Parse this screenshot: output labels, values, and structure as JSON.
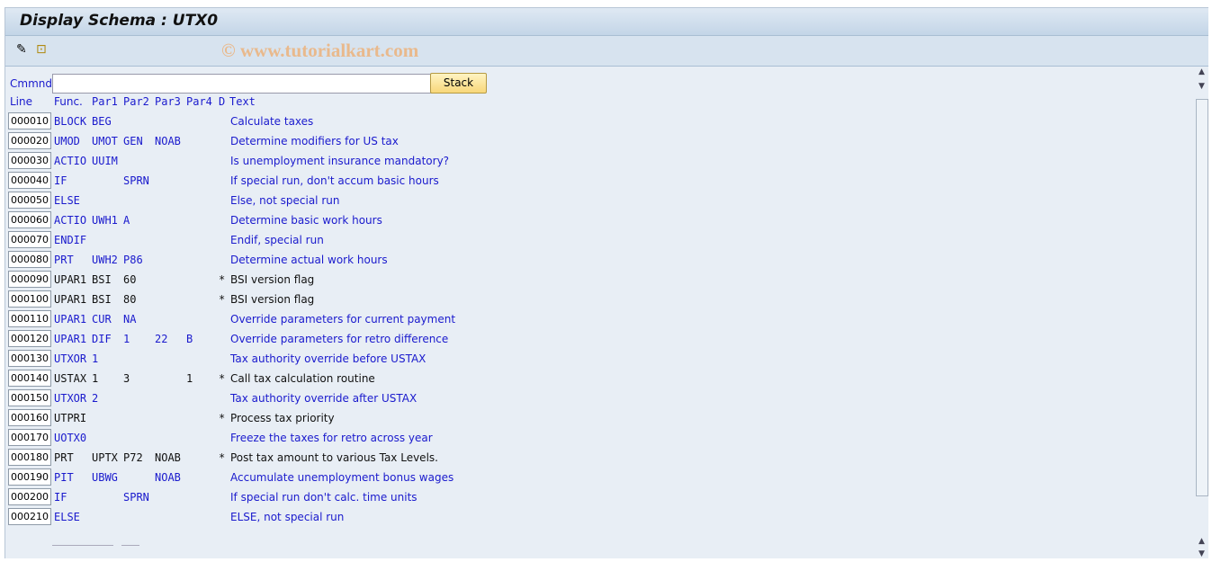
{
  "title": "Display Schema : UTX0",
  "watermark": "© www.tutorialkart.com",
  "toolbar": {
    "icons": [
      "display-change-icon",
      "hierarchy-icon"
    ]
  },
  "command": {
    "label": "Cmmnd",
    "value": "",
    "button": "Stack"
  },
  "headers": {
    "line": "Line",
    "func": "Func.",
    "par1": "Par1",
    "par2": "Par2",
    "par3": "Par3",
    "par4": "Par4",
    "d": "D",
    "text": "Text"
  },
  "rows": [
    {
      "line": "000010",
      "func": "BLOCK",
      "p1": "BEG",
      "p2": "",
      "p3": "",
      "p4": "",
      "d": "",
      "text": "Calculate taxes"
    },
    {
      "line": "000020",
      "func": "UMOD",
      "p1": "UMOT",
      "p2": "GEN",
      "p3": "NOAB",
      "p4": "",
      "d": "",
      "text": "Determine modifiers for US tax"
    },
    {
      "line": "000030",
      "func": "ACTIO",
      "p1": "UUIM",
      "p2": "",
      "p3": "",
      "p4": "",
      "d": "",
      "text": "Is unemployment insurance mandatory?"
    },
    {
      "line": "000040",
      "func": "IF",
      "p1": "",
      "p2": "SPRN",
      "p3": "",
      "p4": "",
      "d": "",
      "text": "If special run, don't accum basic hours"
    },
    {
      "line": "000050",
      "func": "ELSE",
      "p1": "",
      "p2": "",
      "p3": "",
      "p4": "",
      "d": "",
      "text": "Else, not special run"
    },
    {
      "line": "000060",
      "func": "ACTIO",
      "p1": "UWH1",
      "p2": "A",
      "p3": "",
      "p4": "",
      "d": "",
      "text": "Determine basic work hours"
    },
    {
      "line": "000070",
      "func": "ENDIF",
      "p1": "",
      "p2": "",
      "p3": "",
      "p4": "",
      "d": "",
      "text": "Endif, special run"
    },
    {
      "line": "000080",
      "func": "PRT",
      "p1": "UWH2",
      "p2": "P86",
      "p3": "",
      "p4": "",
      "d": "",
      "text": "Determine actual work hours"
    },
    {
      "line": "000090",
      "func": "UPAR1",
      "p1": "BSI",
      "p2": "60",
      "p3": "",
      "p4": "",
      "d": "*",
      "text": "BSI version flag"
    },
    {
      "line": "000100",
      "func": "UPAR1",
      "p1": "BSI",
      "p2": "80",
      "p3": "",
      "p4": "",
      "d": "*",
      "text": "BSI version flag"
    },
    {
      "line": "000110",
      "func": "UPAR1",
      "p1": "CUR",
      "p2": "NA",
      "p3": "",
      "p4": "",
      "d": "",
      "text": "Override parameters for current payment"
    },
    {
      "line": "000120",
      "func": "UPAR1",
      "p1": "DIF",
      "p2": "1",
      "p3": "22",
      "p4": "B",
      "d": "",
      "text": "Override parameters for retro difference"
    },
    {
      "line": "000130",
      "func": "UTXOR",
      "p1": "1",
      "p2": "",
      "p3": "",
      "p4": "",
      "d": "",
      "text": "Tax authority override before USTAX"
    },
    {
      "line": "000140",
      "func": "USTAX",
      "p1": "1",
      "p2": "3",
      "p3": "",
      "p4": "1",
      "d": "*",
      "text": "Call tax calculation routine"
    },
    {
      "line": "000150",
      "func": "UTXOR",
      "p1": "2",
      "p2": "",
      "p3": "",
      "p4": "",
      "d": "",
      "text": "Tax authority override after USTAX"
    },
    {
      "line": "000160",
      "func": "UTPRI",
      "p1": "",
      "p2": "",
      "p3": "",
      "p4": "",
      "d": "*",
      "text": "Process tax priority"
    },
    {
      "line": "000170",
      "func": "UOTX0",
      "p1": "",
      "p2": "",
      "p3": "",
      "p4": "",
      "d": "",
      "text": "Freeze the taxes for retro across year"
    },
    {
      "line": "000180",
      "func": "PRT",
      "p1": "UPTX",
      "p2": "P72",
      "p3": "NOAB",
      "p4": "",
      "d": "*",
      "text": "Post tax amount to various Tax Levels."
    },
    {
      "line": "000190",
      "func": "PIT",
      "p1": "UBWG",
      "p2": "",
      "p3": "NOAB",
      "p4": "",
      "d": "",
      "text": "Accumulate unemployment bonus wages"
    },
    {
      "line": "000200",
      "func": "IF",
      "p1": "",
      "p2": "SPRN",
      "p3": "",
      "p4": "",
      "d": "",
      "text": "If special run don't calc. time units"
    },
    {
      "line": "000210",
      "func": "ELSE",
      "p1": "",
      "p2": "",
      "p3": "",
      "p4": "",
      "d": "",
      "text": "ELSE, not special run"
    }
  ],
  "colors": {
    "active": "#1a1acd",
    "inactive": "#111111"
  }
}
